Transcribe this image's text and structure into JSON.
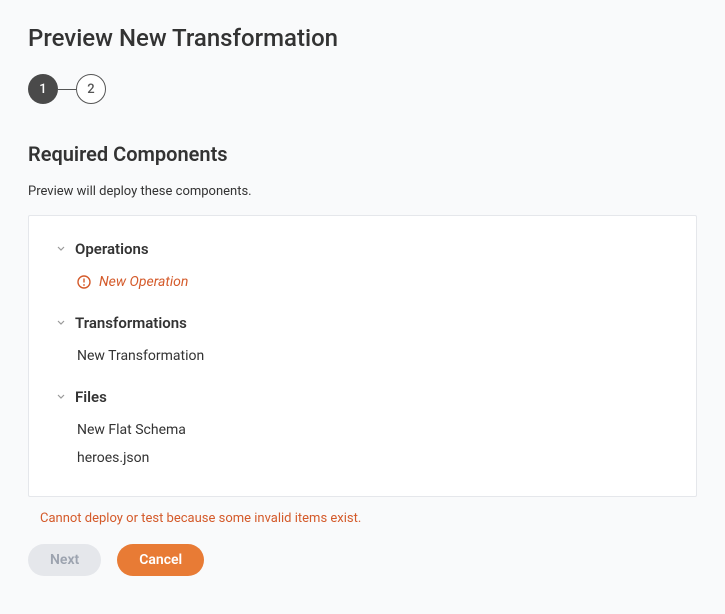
{
  "title": "Preview New Transformation",
  "stepper": {
    "current": "1",
    "next": "2"
  },
  "section": {
    "title": "Required Components",
    "description": "Preview will deploy these components."
  },
  "groups": {
    "operations": {
      "label": "Operations",
      "item0": {
        "label": "New Operation",
        "invalid": true
      }
    },
    "transformations": {
      "label": "Transformations",
      "item0": {
        "label": "New Transformation"
      }
    },
    "files": {
      "label": "Files",
      "item0": {
        "label": "New Flat Schema"
      },
      "item1": {
        "label": "heroes.json"
      }
    }
  },
  "error": "Cannot deploy or test because some invalid items exist.",
  "buttons": {
    "next": "Next",
    "cancel": "Cancel"
  }
}
